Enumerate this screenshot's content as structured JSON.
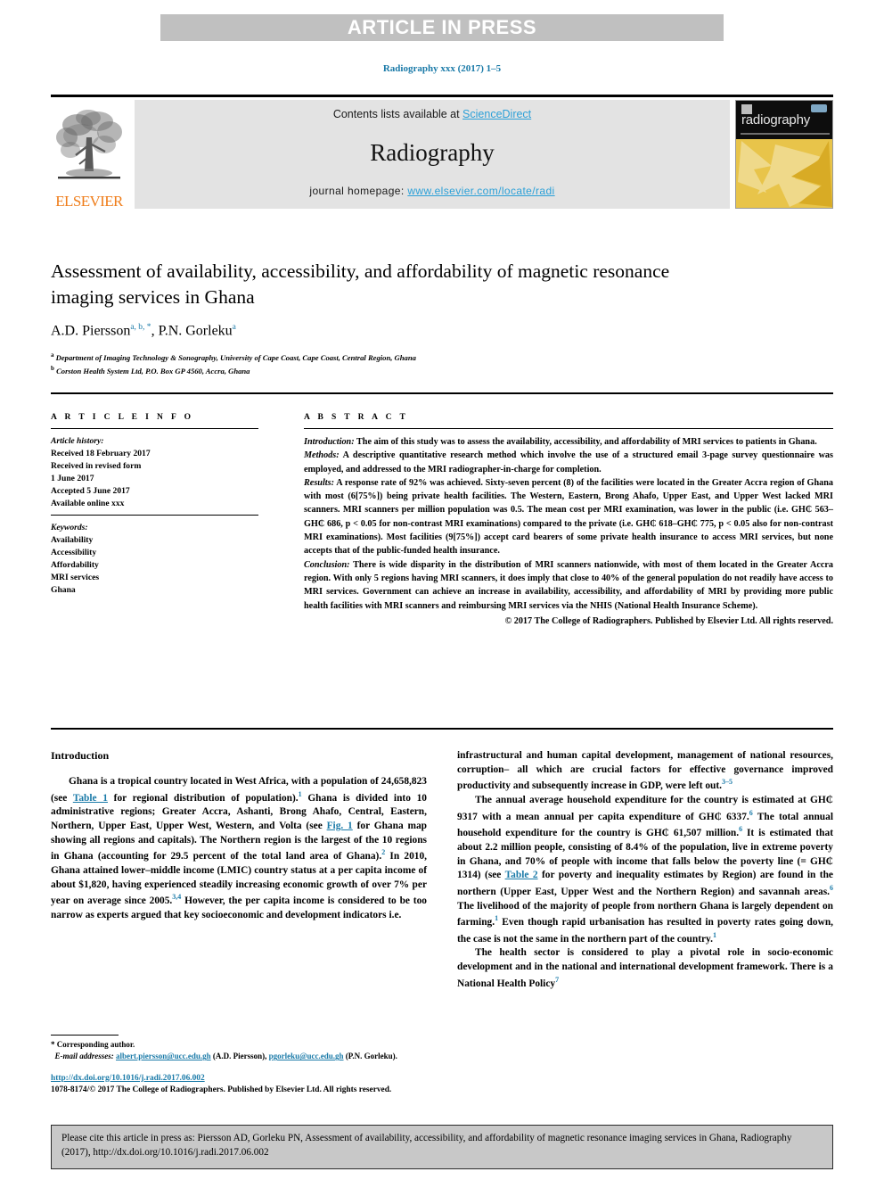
{
  "banner": {
    "text": "ARTICLE IN PRESS"
  },
  "journal_ref": "Radiography xxx (2017) 1–5",
  "masthead": {
    "contents_prefix": "Contents lists available at ",
    "sciencedirect": "ScienceDirect",
    "journal_title": "Radiography",
    "homepage_label": "journal homepage: ",
    "homepage_url": "www.elsevier.com/locate/radi",
    "publisher": "ELSEVIER",
    "cover_word": "radiography"
  },
  "article": {
    "title": "Assessment of availability, accessibility, and affordability of magnetic resonance imaging services in Ghana",
    "authors_1": "A.D. Piersson",
    "authors_1_sup": "a, b, *",
    "authors_sep": ", ",
    "authors_2": "P.N. Gorleku",
    "authors_2_sup": "a",
    "affiliation_a_mark": "a",
    "affiliation_a": "Department of Imaging Technology & Sonography, University of Cape Coast, Cape Coast, Central Region, Ghana",
    "affiliation_b_mark": "b",
    "affiliation_b": "Corston Health System Ltd, P.O. Box GP 4560, Accra, Ghana"
  },
  "info": {
    "heading": "A R T I C L E   I N F O",
    "history_label": "Article history:",
    "history": [
      "Received 18 February 2017",
      "Received in revised form",
      "1 June 2017",
      "Accepted 5 June 2017",
      "Available online xxx"
    ],
    "keywords_label": "Keywords:",
    "keywords": [
      "Availability",
      "Accessibility",
      "Affordability",
      "MRI services",
      "Ghana"
    ]
  },
  "abstract": {
    "heading": "A B S T R A C T",
    "introduction_label": "Introduction:",
    "introduction": " The aim of this study was to assess the availability, accessibility, and affordability of MRI services to patients in Ghana.",
    "methods_label": "Methods:",
    "methods": " A descriptive quantitative research method which involve the use of a structured email 3-page survey questionnaire was employed, and addressed to the MRI radiographer-in-charge for completion.",
    "results_label": "Results:",
    "results": " A response rate of 92% was achieved. Sixty-seven percent (8) of the facilities were located in the Greater Accra region of Ghana with most (6[75%]) being private health facilities. The Western, Eastern, Brong Ahafo, Upper East, and Upper West lacked MRI scanners. MRI scanners per million population was 0.5. The mean cost per MRI examination, was lower in the public (i.e. GH₵ 563–GH₵ 686, p < 0.05 for non-contrast MRI examinations) compared to the private (i.e. GH₵ 618–GH₵ 775, p < 0.05 also for non-contrast MRI examinations). Most facilities (9[75%]) accept card bearers of some private health insurance to access MRI services, but none accepts that of the public-funded health insurance.",
    "conclusion_label": "Conclusion:",
    "conclusion": " There is wide disparity in the distribution of MRI scanners nationwide, with most of them located in the Greater Accra region. With only 5 regions having MRI scanners, it does imply that close to 40% of the general population do not readily have access to MRI services. Government can achieve an increase in availability, accessibility, and affordability of MRI by providing more public health facilities with MRI scanners and reimbursing MRI services via the NHIS (National Health Insurance Scheme).",
    "copyright": "© 2017 The College of Radiographers. Published by Elsevier Ltd. All rights reserved."
  },
  "intro": {
    "heading": "Introduction",
    "p1_a": "Ghana is a tropical country located in West Africa, with a population of 24,658,823 (see ",
    "p1_link1": "Table 1",
    "p1_b": " for regional distribution of population).",
    "p1_sup1": "1",
    "p1_c": " Ghana is divided into 10 administrative regions; Greater Accra, Ashanti, Brong Ahafo, Central, Eastern, Northern, Upper East, Upper West, Western, and Volta (see ",
    "p1_link2": "Fig. 1",
    "p1_d": " for Ghana map showing all regions and capitals). The Northern region is the largest of the 10 regions in Ghana (accounting for 29.5 percent of the total land area of Ghana).",
    "p1_sup2": "2",
    "p1_e": " In 2010, Ghana attained lower–middle income (LMIC) country status at a per capita income of about $1,820, having experienced steadily increasing economic growth of over 7% per year on average since 2005.",
    "p1_sup3": "3,4",
    "p1_f": " However, the per capita income is considered to be too narrow as experts argued that key socioeconomic and development indicators i.e.",
    "p2_a": "infrastructural and human capital development, management of national resources, corruption– all which are crucial factors for effective governance improved productivity and subsequently increase in GDP, were left out.",
    "p2_sup1": "3–5",
    "p3_a": "The annual average household expenditure for the country is estimated at GH₵ 9317 with a mean annual per capita expenditure of GH₵ 6337.",
    "p3_sup1": "6",
    "p3_b": " The total annual household expenditure for the country is GH₵ 61,507 million.",
    "p3_sup2": "6",
    "p3_c": " It is estimated that about 2.2 million people, consisting of 8.4% of the population, live in extreme poverty in Ghana, and 70% of people with income that falls below the poverty line (= GH₵ 1314) (see ",
    "p3_link1": "Table 2",
    "p3_d": " for poverty and inequality estimates by Region) are found in the northern (Upper East, Upper West and the Northern Region) and savannah areas.",
    "p3_sup3": "6",
    "p3_e": " The livelihood of the majority of people from northern Ghana is largely dependent on farming.",
    "p3_sup4": "1",
    "p3_f": " Even though rapid urbanisation has resulted in poverty rates going down, the case is not the same in the northern part of the country.",
    "p3_sup5": "1",
    "p4_a": "The health sector is considered to play a pivotal role in socio-economic development and in the national and international development framework. There is a National Health Policy",
    "p4_sup1": "7"
  },
  "footnote": {
    "corresponding": "* Corresponding author.",
    "email_label": "E-mail addresses:",
    "email_1": "albert.piersson@ucc.edu.gh",
    "email_1_name": " (A.D. Piersson), ",
    "email_2": "pgorleku@ucc.edu.gh",
    "email_2_name": " (P.N. Gorleku).",
    "doi": "http://dx.doi.org/10.1016/j.radi.2017.06.002",
    "issn_line": "1078-8174/© 2017 The College of Radiographers. Published by Elsevier Ltd. All rights reserved."
  },
  "cite_box": {
    "text": "Please cite this article in press as: Piersson AD, Gorleku PN, Assessment of availability, accessibility, and affordability of magnetic resonance imaging services in Ghana, Radiography (2017), http://dx.doi.org/10.1016/j.radi.2017.06.002"
  },
  "colors": {
    "link_blue": "#1a7aa8",
    "sd_blue": "#2ba0d8",
    "elsevier_orange": "#ef7d1a",
    "banner_gray": "#c0c0c0",
    "box_gray": "#e3e3e3",
    "cite_gray": "#c8c8c8",
    "cover_gold": "#e8c44a"
  }
}
